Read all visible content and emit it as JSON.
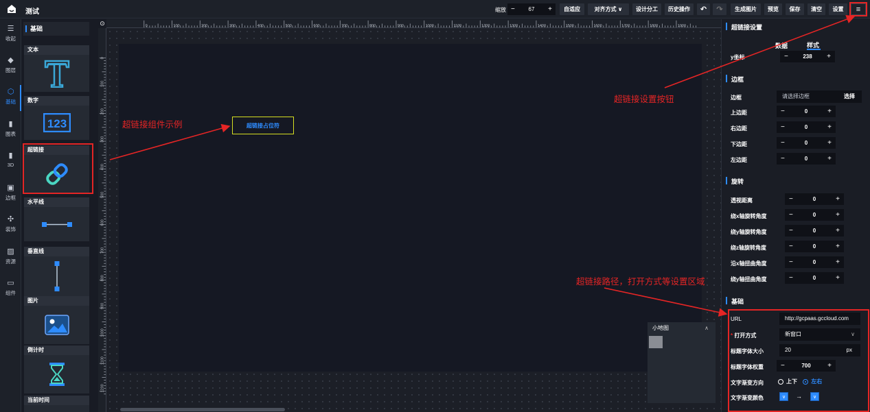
{
  "app": {
    "title": "测试"
  },
  "toolbar": {
    "zoom_label": "缩放",
    "zoom_value": "67",
    "minus": "−",
    "plus": "+",
    "buttons": {
      "auto_fit": "自适应",
      "align": "对齐方式 ∨",
      "design_split": "设计分工",
      "history": "历史操作",
      "undo": "↶",
      "redo": "↷",
      "gen_image": "生成图片",
      "preview": "预览",
      "save": "保存",
      "clear": "清空",
      "settings": "设置",
      "menu": "≡"
    }
  },
  "sidebar": {
    "items": [
      {
        "icon": "☰",
        "label": "收起"
      },
      {
        "icon": "◆",
        "label": "图层"
      },
      {
        "icon": "⬡",
        "label": "基础"
      },
      {
        "icon": "▮",
        "label": "图表"
      },
      {
        "icon": "▮",
        "label": "3D"
      },
      {
        "icon": "▣",
        "label": "边框"
      },
      {
        "icon": "✣",
        "label": "装饰"
      },
      {
        "icon": "▨",
        "label": "资源"
      },
      {
        "icon": "▭",
        "label": "组件"
      }
    ]
  },
  "components": {
    "header": "基础",
    "items": [
      {
        "label": "文本"
      },
      {
        "label": "数字"
      },
      {
        "label": "超链接"
      },
      {
        "label": "水平线"
      },
      {
        "label": "垂直线"
      },
      {
        "label": "图片"
      },
      {
        "label": "倒计时"
      },
      {
        "label": "当前时间"
      }
    ]
  },
  "ruler": {
    "top": [
      "0",
      "100",
      "200",
      "300",
      "400",
      "500",
      "600",
      "700",
      "800",
      "900",
      "1000",
      "1100",
      "1200",
      "1300",
      "1400",
      "1500",
      "1600",
      "1700",
      "1800",
      "1900"
    ],
    "left": [
      "0",
      "100",
      "200",
      "300",
      "400",
      "500",
      "600",
      "700",
      "800",
      "900",
      "1000",
      "1100",
      "1200"
    ]
  },
  "canvas": {
    "hyperlink_text": "超链接占位符",
    "minimap_title": "小地图"
  },
  "annotations": {
    "example": "超链接组件示例",
    "settings_btn": "超链接设置按钮",
    "path": "超链接路径，打开方式等设置区域"
  },
  "panel": {
    "title": "超链接设置",
    "tab_data": "数据",
    "tab_style": "样式",
    "y_label": "y坐标",
    "y_value": "238",
    "border_section": "边框",
    "border_label": "边框",
    "border_placeholder": "请选择边框",
    "border_select": "选择",
    "padding": [
      {
        "label": "上边距",
        "value": "0"
      },
      {
        "label": "右边距",
        "value": "0"
      },
      {
        "label": "下边距",
        "value": "0"
      },
      {
        "label": "左边距",
        "value": "0"
      }
    ],
    "rotate_section": "旋转",
    "rotate": [
      {
        "label": "透视距离",
        "value": "0"
      },
      {
        "label": "绕x轴旋转角度",
        "value": "0"
      },
      {
        "label": "绕y轴旋转角度",
        "value": "0"
      },
      {
        "label": "绕z轴旋转角度",
        "value": "0"
      },
      {
        "label": "沿x轴扭曲角度",
        "value": "0"
      },
      {
        "label": "绕y轴扭曲角度",
        "value": "0"
      }
    ],
    "base_section": "基础",
    "url_label": "URL",
    "url_value": "http://gcpaas.gccloud.com",
    "open_label": "打开方式",
    "open_required": "*",
    "open_value": "新窗口",
    "font_size_label": "标题字体大小",
    "font_size_value": "20",
    "font_size_unit": "px",
    "font_weight_label": "标题字体权重",
    "font_weight_value": "700",
    "gradient_dir_label": "文字渐变方向",
    "dir_opt1": "上下",
    "dir_opt2": "左右",
    "gradient_color_label": "文字渐变颜色",
    "arrow": "→"
  },
  "colors": {
    "accent": "#2e8cff",
    "annotation": "#e52525",
    "hyperlink_border": "#d7e021"
  }
}
